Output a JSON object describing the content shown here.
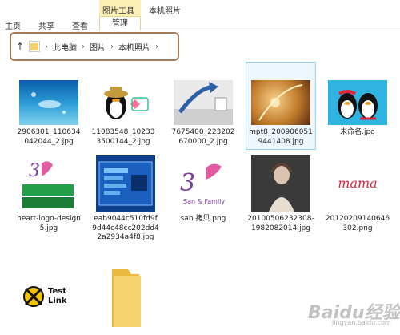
{
  "ribbon": {
    "tabs": [
      "主页",
      "共享",
      "查看"
    ],
    "context_group": "图片工具",
    "context_tab": "管理",
    "window_title": "本机照片"
  },
  "address": {
    "crumbs": [
      "此电脑",
      "图片",
      "本机照片"
    ]
  },
  "files": [
    {
      "name": "2906301_110634042044_2.jpg",
      "kind": "sea"
    },
    {
      "name": "11083548_102333500144_2.jpg",
      "kind": "penguin"
    },
    {
      "name": "7675400_223202670000_2.jpg",
      "kind": "tech"
    },
    {
      "name": "mpt8_2009060519441408.jpg",
      "kind": "art"
    },
    {
      "name": "未命名.jpg",
      "kind": "qq"
    },
    {
      "name": "heart-logo-design5.jpg",
      "kind": "heartlogo"
    },
    {
      "name": "eab9044c510fd9f9d44c48cc202dd42a2934a4f8.jpg",
      "kind": "screen"
    },
    {
      "name": "san 拷贝.png",
      "kind": "sanfamily"
    },
    {
      "name": "20100506232308-1982082014.jpg",
      "kind": "lady"
    },
    {
      "name": "20120209140646302.png",
      "kind": "mama"
    },
    {
      "name": "",
      "kind": "testlink"
    },
    {
      "name": "",
      "kind": "folder"
    }
  ],
  "thumb_text": {
    "testlink": "Test Link",
    "mama": "mama",
    "family": "San & Family"
  },
  "watermark": "Baidu经验",
  "watermark_sub": "jingyan.baidu.com"
}
